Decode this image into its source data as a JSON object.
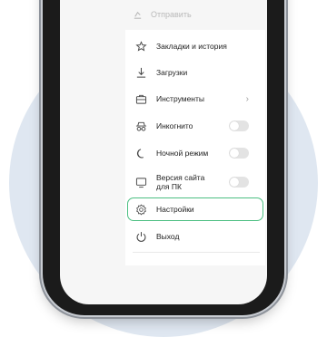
{
  "menu": {
    "send_label": "Отправить",
    "items": [
      {
        "label": "Закладки и история",
        "icon": "star-history-icon"
      },
      {
        "label": "Загрузки",
        "icon": "download-icon"
      },
      {
        "label": "Инструменты",
        "icon": "toolbox-icon",
        "chevron": "›"
      },
      {
        "label": "Инкогнито",
        "icon": "incognito-icon",
        "toggle": false
      },
      {
        "label": "Ночной режим",
        "icon": "moon-icon",
        "toggle": false
      },
      {
        "label": "Версия сайта для ПК",
        "icon": "desktop-icon",
        "toggle": false
      },
      {
        "label": "Настройки",
        "icon": "gear-icon",
        "highlighted": true
      },
      {
        "label": "Выход",
        "icon": "power-icon"
      }
    ]
  },
  "colors": {
    "highlight": "#4bbf81",
    "background_circle": "#dfe7f1"
  }
}
